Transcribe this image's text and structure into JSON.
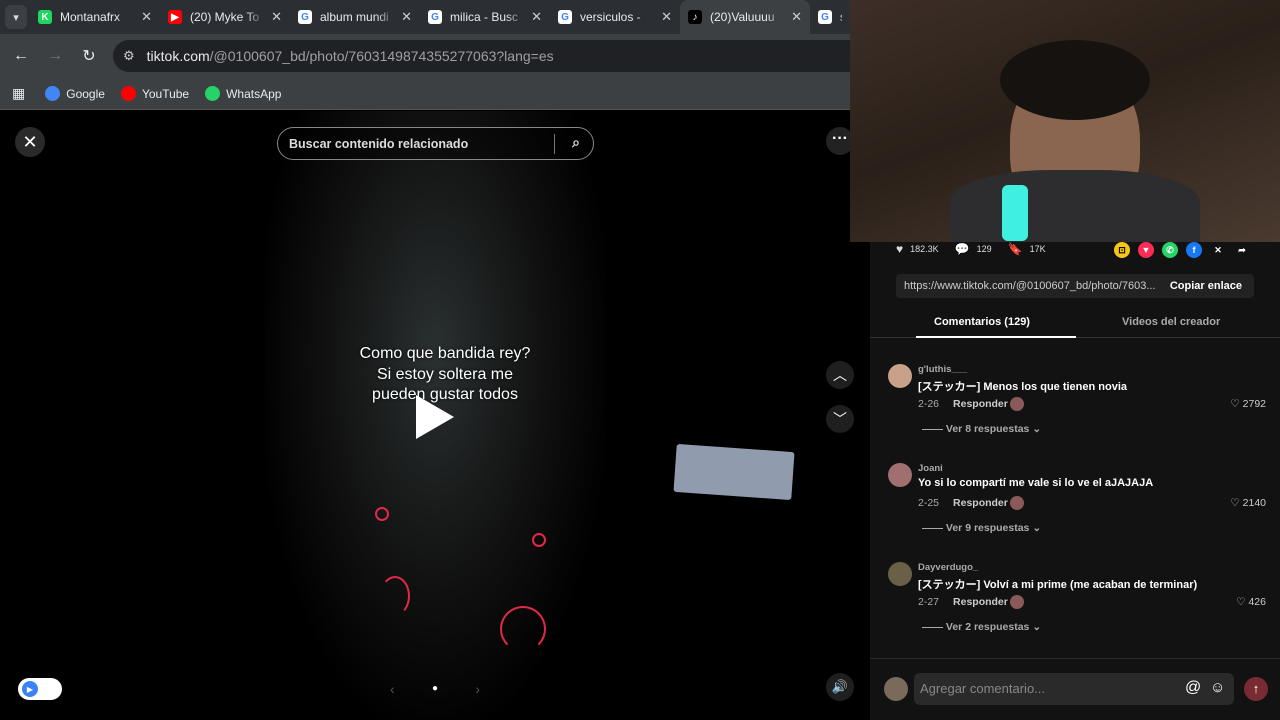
{
  "browser": {
    "tabs": [
      {
        "title": "Montanafrx",
        "fav_color": "#1ed760",
        "fav_glyph": "K",
        "active": false
      },
      {
        "title": "(20) Myke To",
        "fav_color": "#ff0000",
        "fav_glyph": "▶",
        "active": false
      },
      {
        "title": "album mundi",
        "fav_color": "#ffffff",
        "fav_glyph": "G",
        "active": false
      },
      {
        "title": "milica - Busc",
        "fav_color": "#ffffff",
        "fav_glyph": "G",
        "active": false
      },
      {
        "title": "versiculos - ",
        "fav_color": "#ffffff",
        "fav_glyph": "G",
        "active": false
      },
      {
        "title": "(20)Valuuuu",
        "fav_color": "#000000",
        "fav_glyph": "♪",
        "active": true
      },
      {
        "title": "s",
        "fav_color": "#ffffff",
        "fav_glyph": "G",
        "active": false
      }
    ],
    "url_host": "tiktok.com",
    "url_path": "/@0100607_bd/photo/7603149874355277063?lang=es",
    "bookmarks": [
      {
        "label": "Google",
        "color": "#4285f4"
      },
      {
        "label": "YouTube",
        "color": "#ff0000"
      },
      {
        "label": "WhatsApp",
        "color": "#25d366"
      }
    ]
  },
  "viewer": {
    "search_placeholder": "Buscar contenido relacionado",
    "caption_line1": "Como que bandida rey?",
    "caption_line2": "Si estoy soltera me",
    "caption_line3": "pueden gustar todos"
  },
  "panel": {
    "likes": "182.3K",
    "comments_count": "129",
    "saves": "17K",
    "link": "https://www.tiktok.com/@0100607_bd/photo/7603...",
    "copy_label": "Copiar enlace",
    "tab_comments": "Comentarios (129)",
    "tab_creator": "Videos del creador",
    "comments": [
      {
        "user": "g'luthis___",
        "text": "[ステッカー] Menos los que tienen novia",
        "date": "2-26",
        "reply": "Responder",
        "likes": "2792",
        "replies": "Ver 8 respuestas",
        "avatar": "#c9a08a"
      },
      {
        "user": "Joani",
        "text": "Yo si lo compartí me vale si lo ve el aJAJAJA",
        "date": "2-25",
        "reply": "Responder",
        "likes": "2140",
        "replies": "Ver 9 respuestas",
        "avatar": "#a07070"
      },
      {
        "user": "Dayverdugo_",
        "text": "[ステッカー] Volví a mi prime (me acaban de terminar)",
        "date": "2-27",
        "reply": "Responder",
        "likes": "426",
        "replies": "Ver 2 respuestas",
        "avatar": "#6a6048"
      }
    ],
    "add_comment_placeholder": "Agregar comentario..."
  }
}
